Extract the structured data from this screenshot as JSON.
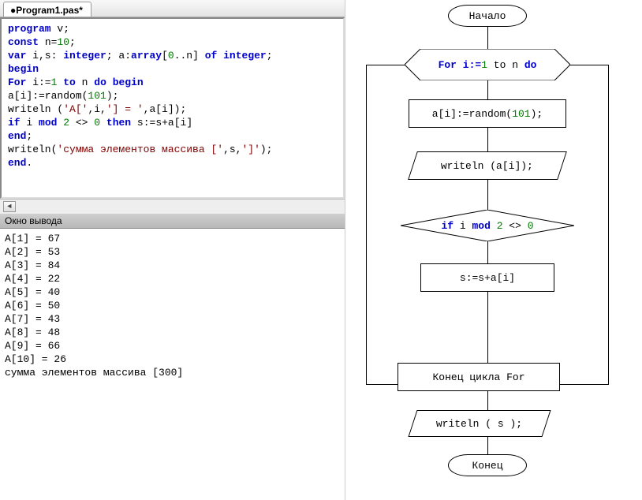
{
  "tab": {
    "title": "●Program1.pas*"
  },
  "code": {
    "l1a": "program",
    "l1b": " v;",
    "l2a": "const",
    "l2b": " n=",
    "l2c": "10",
    "l2d": ";",
    "l3a": "var",
    "l3b": " i,s: ",
    "l3c": "integer",
    "l3d": "; a:",
    "l3e": "array",
    "l3f": "[",
    "l3g": "0",
    "l3h": "..n] ",
    "l3i": "of",
    "l3j": " ",
    "l3k": "integer",
    "l3l": ";",
    "l4": "begin",
    "l5a": "For",
    "l5b": " i:=",
    "l5c": "1",
    "l5d": " ",
    "l5e": "to",
    "l5f": " n ",
    "l5g": "do",
    "l5h": " ",
    "l5i": "begin",
    "l6a": "a[i]:=random(",
    "l6b": "101",
    "l6c": ");",
    "l7a": "writeln (",
    "l7b": "'A['",
    "l7c": ",i,",
    "l7d": "'] = '",
    "l7e": ",a[i]);",
    "l8a": "if",
    "l8b": " i ",
    "l8c": "mod",
    "l8d": " ",
    "l8e": "2",
    "l8f": " <> ",
    "l8g": "0",
    "l8h": " ",
    "l8i": "then",
    "l8j": " s:=s+a[i]",
    "l9": "end",
    "l9b": ";",
    "l10a": "writeln(",
    "l10b": "'сумма элементов массива ['",
    "l10c": ",s,",
    "l10d": "']'",
    "l10e": ");",
    "l11": "end",
    "l11b": "."
  },
  "outputHeader": "Окно вывода",
  "output": "A[1] = 67\nA[2] = 53\nA[3] = 84\nA[4] = 22\nA[5] = 40\nA[6] = 50\nA[7] = 43\nA[8] = 48\nA[9] = 66\nA[10] = 26\nсумма элементов массива [300]",
  "flow": {
    "start": "Начало",
    "for": {
      "a": "For i:=",
      "b": "1",
      "c": " to n ",
      "d": "do"
    },
    "assign": {
      "a": "a[i]:=random(",
      "b": "101",
      "c": ");"
    },
    "write1": "writeln (a[i]);",
    "cond": {
      "a": "if",
      "b": " i ",
      "c": "mod",
      "d": " ",
      "e": "2",
      "f": " <> ",
      "g": "0"
    },
    "sum": "s:=s+a[i]",
    "endloop": "Конец цикла For",
    "write2": "writeln ( s );",
    "end": "Конец"
  }
}
